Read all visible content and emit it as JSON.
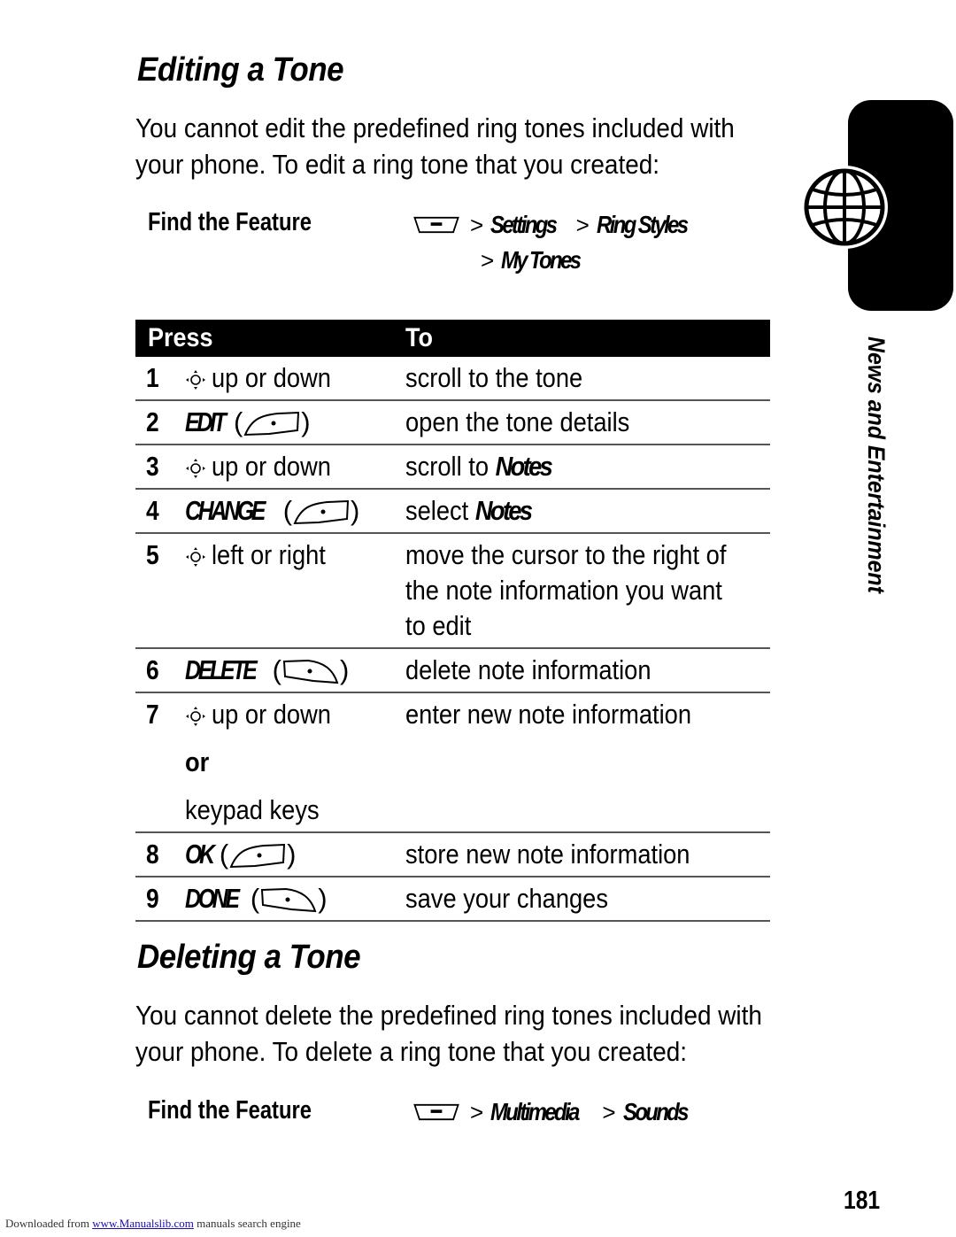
{
  "editing": {
    "title": "Editing a Tone",
    "intro_line1": "You cannot edit the predefined ring tones included with",
    "intro_line2": "your phone. To edit a ring tone that you created:",
    "find_feature_label": "Find the Feature",
    "path": [
      "Settings",
      "Ring Styles",
      "My Tones"
    ],
    "table": {
      "headers": {
        "press": "Press",
        "to": "To"
      },
      "rows": [
        {
          "num": "1",
          "press_type": "nav",
          "press": "up or down",
          "to": "scroll to the tone"
        },
        {
          "num": "2",
          "press_type": "softkey",
          "softkey": "EDIT",
          "key_icon": "right-soft-key-icon",
          "to": "open the tone details"
        },
        {
          "num": "3",
          "press_type": "nav",
          "press": "up or down",
          "to_prefix": "scroll to",
          "to_item": "Notes"
        },
        {
          "num": "4",
          "press_type": "softkey",
          "softkey": "CHANGE",
          "key_icon": "right-soft-key-icon",
          "to_prefix": "select",
          "to_item": "Notes"
        },
        {
          "num": "5",
          "press_type": "nav",
          "press": "left or right",
          "to_lines": [
            "move the cursor to the right of",
            "the note information you want",
            "to edit"
          ]
        },
        {
          "num": "6",
          "press_type": "softkey",
          "softkey": "DELETE",
          "key_icon": "left-soft-key-icon",
          "to": "delete note information"
        },
        {
          "num": "7",
          "press_type": "nav",
          "press": "up or down",
          "or_label": "or",
          "alt_press": "keypad keys",
          "to": "enter new note information"
        },
        {
          "num": "8",
          "press_type": "softkey",
          "softkey": "OK",
          "key_icon": "right-soft-key-icon",
          "to": "store new note information"
        },
        {
          "num": "9",
          "press_type": "softkey",
          "softkey": "DONE",
          "key_icon": "left-soft-key-icon",
          "to": "save your changes"
        }
      ]
    }
  },
  "deleting": {
    "title": "Deleting a Tone",
    "intro_line1": "You cannot delete the predefined ring tones included with",
    "intro_line2": "your phone. To delete a ring tone that you created:",
    "find_feature_label": "Find the Feature",
    "path": [
      "Multimedia",
      "Sounds"
    ]
  },
  "side_tab": {
    "section_label": "News and Entertainment",
    "icon": "globe-icon"
  },
  "page_number": "181",
  "footer": {
    "prefix": "Downloaded from ",
    "link": "www.Manualslib.com",
    "suffix": " manuals search engine"
  }
}
